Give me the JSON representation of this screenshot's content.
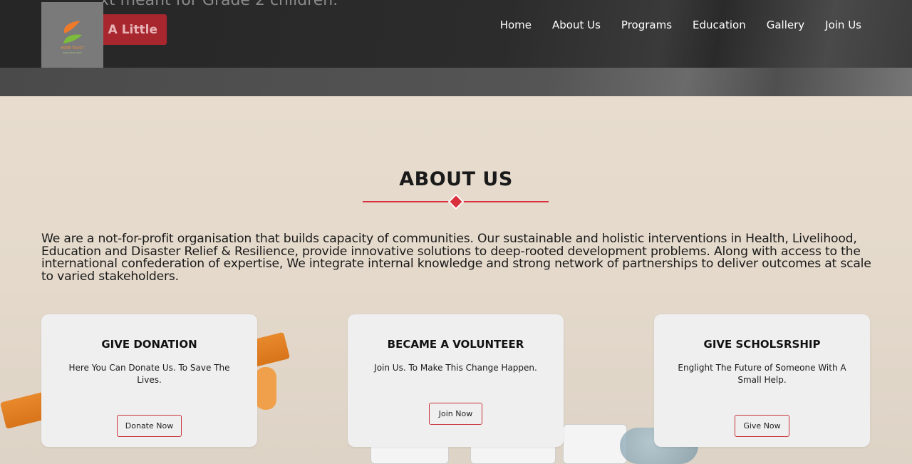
{
  "header": {
    "hero_text_clip": "xt meant for Grade 2 children.",
    "hero_cta": "th A Little",
    "logo": {
      "name": "HOPE TRUST",
      "sub": "lorem ipsum dolor"
    },
    "nav": [
      "Home",
      "About Us",
      "Programs",
      "Education",
      "Gallery",
      "Join Us"
    ]
  },
  "about": {
    "title": "ABOUT US",
    "text": "We are a not-for-profit organisation that builds capacity of communities. Our sustainable and holistic interventions in Health, Livelihood, Education and Disaster Relief & Resilience, provide innovative solutions to deep-rooted development problems. Along with access to the international confederation of expertise, We integrate internal knowledge and strong network of partnerships to deliver outcomes at scale to varied stakeholders."
  },
  "cards": [
    {
      "title": "GIVE DONATION",
      "text": "Here You Can Donate Us. To Save The Lives.",
      "button": "Donate Now"
    },
    {
      "title": "BECAME A VOLUNTEER",
      "text": "Join Us. To Make This Change Happen.",
      "button": "Join Now"
    },
    {
      "title": "GIVE SCHOLSRSHIP",
      "text": "Englight The Future of Someone With A Small Help.",
      "button": "Give Now"
    }
  ],
  "colors": {
    "accent": "#d9303d",
    "header_bg": "#2a2a2a",
    "section_bg": "#e4d9cc",
    "card_bg": "#efefef"
  }
}
